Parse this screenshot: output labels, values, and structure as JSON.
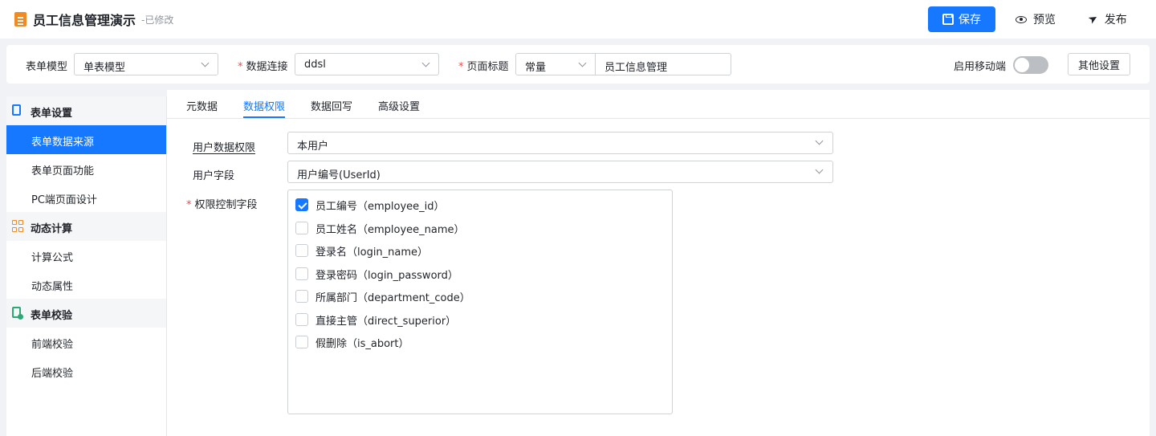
{
  "header": {
    "title": "员工信息管理演示",
    "status": "-已修改",
    "save_label": "保存",
    "preview_label": "预览",
    "publish_label": "发布"
  },
  "config": {
    "form_model_label": "表单模型",
    "form_model_value": "单表模型",
    "data_connection_label": "数据连接",
    "data_connection_value": "ddsl",
    "page_title_label": "页面标题",
    "page_title_type": "常量",
    "page_title_value": "员工信息管理",
    "mobile_label": "启用移动端",
    "mobile_enabled": false,
    "other_settings_label": "其他设置"
  },
  "sidebar": {
    "groups": [
      {
        "label": "表单设置",
        "icon": "form-settings-icon",
        "items": [
          {
            "label": "表单数据来源",
            "active": true
          },
          {
            "label": "表单页面功能",
            "active": false
          },
          {
            "label": "PC端页面设计",
            "active": false
          }
        ]
      },
      {
        "label": "动态计算",
        "icon": "dynamic-calc-icon",
        "items": [
          {
            "label": "计算公式",
            "active": false
          },
          {
            "label": "动态属性",
            "active": false
          }
        ]
      },
      {
        "label": "表单校验",
        "icon": "form-validation-icon",
        "items": [
          {
            "label": "前端校验",
            "active": false
          },
          {
            "label": "后端校验",
            "active": false
          }
        ]
      }
    ]
  },
  "tabs": [
    {
      "label": "元数据",
      "active": false
    },
    {
      "label": "数据权限",
      "active": true
    },
    {
      "label": "数据回写",
      "active": false
    },
    {
      "label": "高级设置",
      "active": false
    }
  ],
  "permission": {
    "user_permission_label": "用户数据权限",
    "user_permission_value": "本用户",
    "user_field_label": "用户字段",
    "user_field_value": "用户编号(UserId)",
    "control_field_label": "权限控制字段",
    "fields": [
      {
        "label": "员工编号（employee_id）",
        "checked": true
      },
      {
        "label": "员工姓名（employee_name）",
        "checked": false
      },
      {
        "label": "登录名（login_name）",
        "checked": false
      },
      {
        "label": "登录密码（login_password）",
        "checked": false
      },
      {
        "label": "所属部门（department_code）",
        "checked": false
      },
      {
        "label": "直接主管（direct_superior）",
        "checked": false
      },
      {
        "label": "假删除（is_abort）",
        "checked": false
      }
    ]
  },
  "colors": {
    "accent": "#1677ff",
    "required": "#f54a45",
    "toggle_off": "#bbbfc4"
  }
}
